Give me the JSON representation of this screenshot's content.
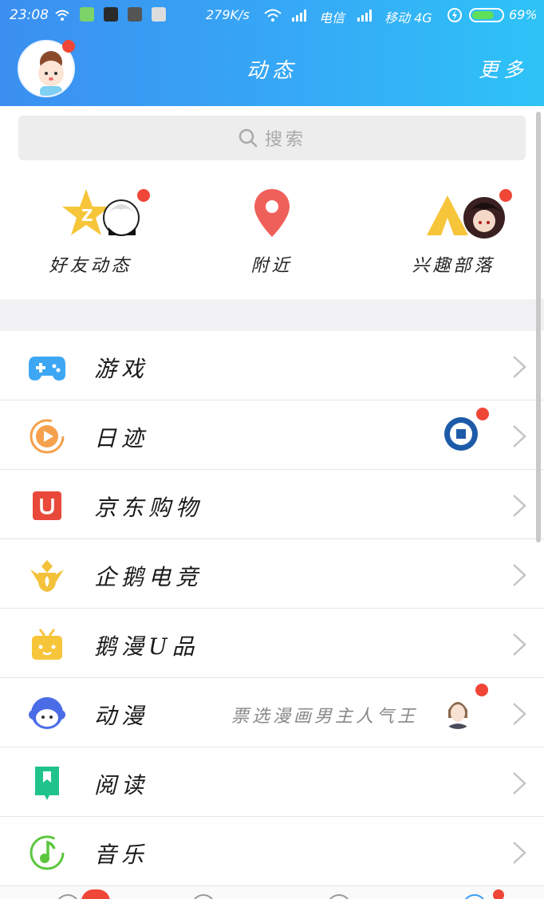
{
  "status_bar": {
    "time": "23:08",
    "speed": "279K/s",
    "carrier1": "电信",
    "carrier2": "移动 4G",
    "battery": "69%"
  },
  "header": {
    "title": "动态",
    "more_label": "更多"
  },
  "search": {
    "placeholder": "搜索"
  },
  "quick_items": [
    {
      "label": "好友动态",
      "icon": "star-friends-icon",
      "has_badge": true
    },
    {
      "label": "附近",
      "icon": "location-pin-icon",
      "has_badge": false
    },
    {
      "label": "兴趣部落",
      "icon": "tent-icon",
      "has_badge": true
    }
  ],
  "list_items": [
    {
      "label": "游戏",
      "icon": "gamepad-icon",
      "extra": ""
    },
    {
      "label": "日迹",
      "icon": "play-circle-icon",
      "extra": ""
    },
    {
      "label": "京东购物",
      "icon": "shopping-bag-icon",
      "extra": ""
    },
    {
      "label": "企鹅电竞",
      "icon": "esports-crown-icon",
      "extra": ""
    },
    {
      "label": "鹅漫U品",
      "icon": "gift-box-icon",
      "extra": ""
    },
    {
      "label": "动漫",
      "icon": "anime-face-icon",
      "extra": "票选漫画男主人气王"
    },
    {
      "label": "阅读",
      "icon": "bookmark-book-icon",
      "extra": ""
    },
    {
      "label": "音乐",
      "icon": "music-note-icon",
      "extra": ""
    }
  ],
  "colors": {
    "header_gradient_start": "#3b8ff0",
    "header_gradient_end": "#2ec3f7",
    "badge": "#f04638",
    "game_blue": "#3da7f3",
    "orange": "#f5a04c",
    "jd_red": "#e8493a",
    "gold": "#f3c23a",
    "yellow": "#f7c53a",
    "anime_blue": "#4a6ce6",
    "read_green": "#21c38d",
    "music_green": "#5cc73e"
  }
}
